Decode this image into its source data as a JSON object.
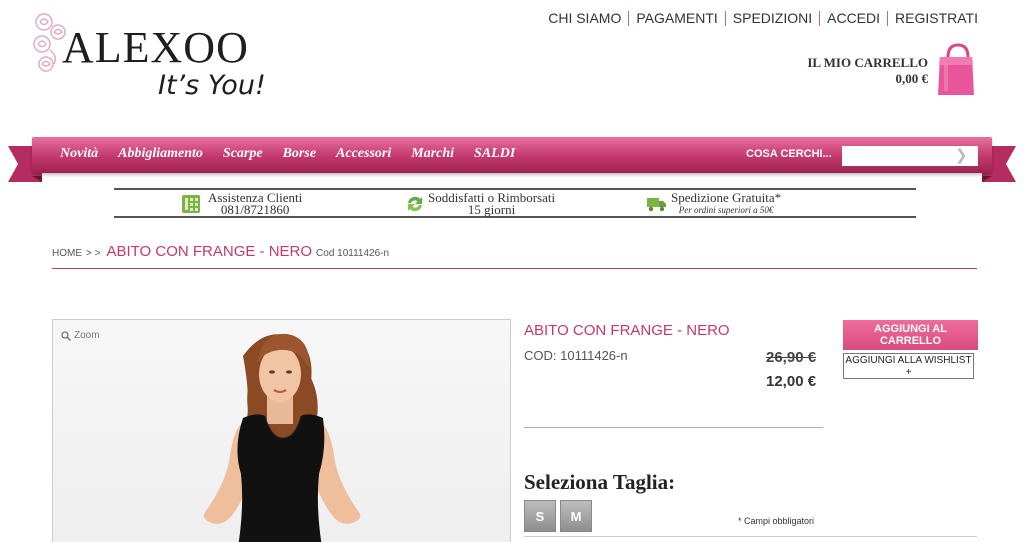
{
  "logo": {
    "brand": "ALEXOO",
    "tagline": "It’s You!"
  },
  "top_links": [
    "CHI SIAMO",
    "PAGAMENTI",
    "SPEDIZIONI",
    "ACCEDI",
    "REGISTRATI"
  ],
  "cart": {
    "label": "IL MIO CARRELLO",
    "total": "0,00 €",
    "icon": "shopping-bag-icon"
  },
  "nav": {
    "items": [
      "Novità",
      "Abbigliamento",
      "Scarpe",
      "Borse",
      "Accessori",
      "Marchi",
      "SALDI"
    ],
    "search_label": "COSA CERCHI...",
    "search_value": "",
    "search_icon": "chevron-right-icon"
  },
  "info_bar": [
    {
      "icon": "phone-calculator-icon",
      "title": "Assistenza Clienti",
      "subtitle": "081/8721860"
    },
    {
      "icon": "refresh-arrows-icon",
      "title": "Soddisfatti o Rimborsati",
      "subtitle": "15 giorni"
    },
    {
      "icon": "delivery-truck-icon",
      "title": "Spedizione Gratuita*",
      "subtitle": "Per ordini superiori a 50€"
    }
  ],
  "breadcrumb": {
    "home": "HOME",
    "separators": "> >",
    "current": "ABITO CON FRANGE - NERO",
    "code": "Cod 10111426-n"
  },
  "product": {
    "zoom_label": "Zoom",
    "title": "ABITO CON FRANGE - NERO",
    "cod_label": "COD:",
    "cod_value": "10111426-n",
    "old_price": "26,90 €",
    "price": "12,00 €",
    "size_title": "Seleziona Taglia:",
    "sizes": [
      "S",
      "M"
    ],
    "required_note": "* Campi obbligatori",
    "add_to_cart": "AGGIUNGI AL CARRELLO",
    "add_to_wishlist": "AGGIUNGI ALLA WISHLIST",
    "wishlist_plus": "+"
  },
  "colors": {
    "accent": "#c23a6b",
    "nav_top": "#e8709e",
    "nav_bottom": "#9d2250",
    "button": "#e05a88"
  }
}
